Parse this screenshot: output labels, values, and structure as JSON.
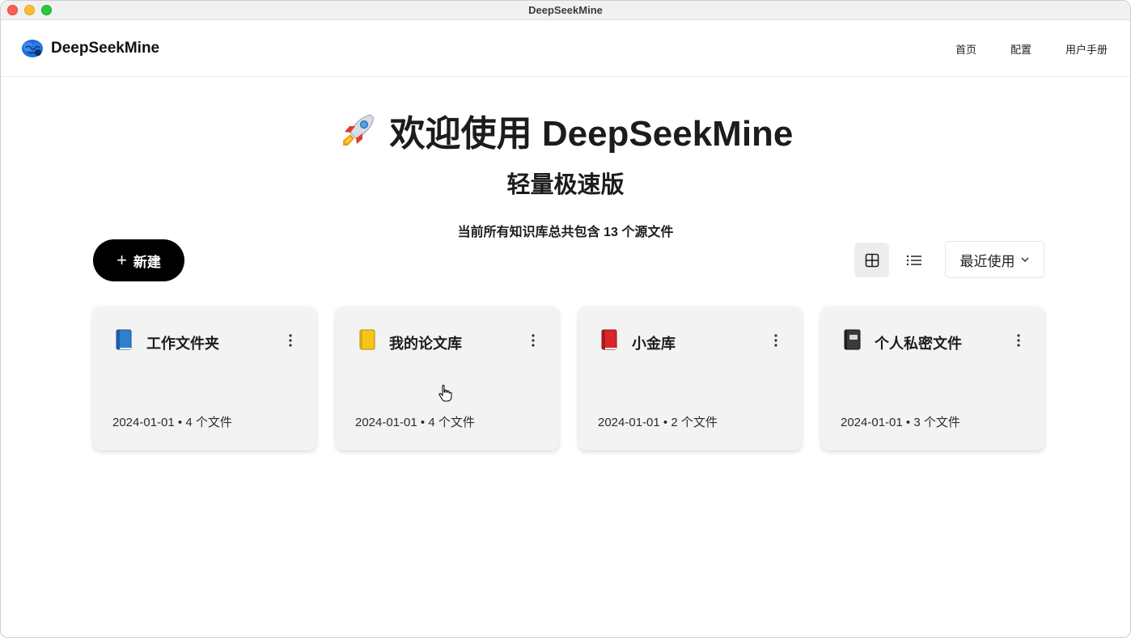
{
  "window": {
    "title": "DeepSeekMine"
  },
  "navbar": {
    "brand": "DeepSeekMine",
    "links": [
      "首页",
      "配置",
      "用户手册"
    ]
  },
  "hero": {
    "title": "欢迎使用 DeepSeekMine",
    "subtitle": "轻量极速版",
    "summary": "当前所有知识库总共包含 13 个源文件"
  },
  "toolbar": {
    "new_label": "新建",
    "sort_label": "最近使用"
  },
  "cards": [
    {
      "title": "工作文件夹",
      "meta": "2024-01-01 • 4 个文件",
      "icon": "blue-book-icon"
    },
    {
      "title": "我的论文库",
      "meta": "2024-01-01 • 4 个文件",
      "icon": "yellow-notebook-icon"
    },
    {
      "title": "小金库",
      "meta": "2024-01-01 • 2 个文件",
      "icon": "red-book-icon"
    },
    {
      "title": "个人私密文件",
      "meta": "2024-01-01 • 3 个文件",
      "icon": "black-notebook-icon"
    }
  ],
  "colors": {
    "primary_button": "#000000",
    "text": "#1c1c1e",
    "card_bg": "#f3f3f3",
    "accent_logo": "#1e6fd9"
  }
}
